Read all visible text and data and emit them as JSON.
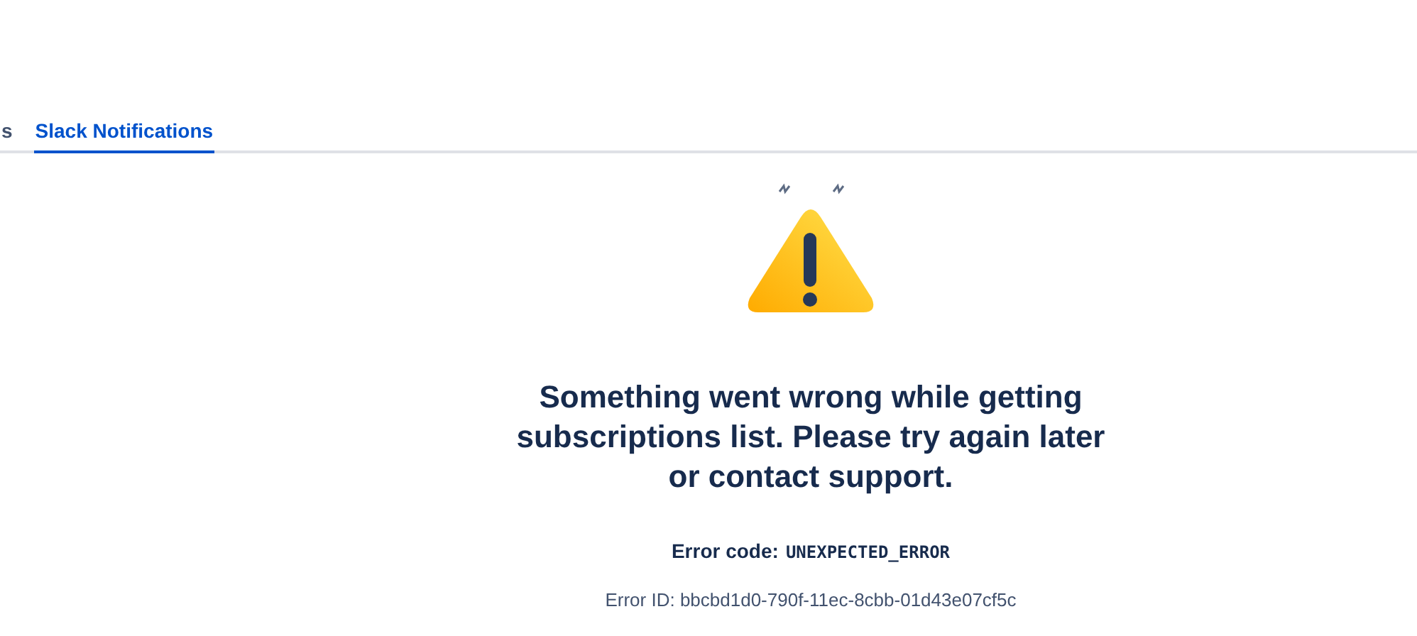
{
  "tabs": [
    {
      "label": "s",
      "selected": false
    },
    {
      "label": "Slack Notifications",
      "selected": true
    }
  ],
  "error": {
    "message": "Something went wrong while getting subscriptions list. Please try again later or contact support.",
    "code_label": "Error code:",
    "code": "UNEXPECTED_ERROR",
    "error_id": "Error ID: bbcbd1d0-790f-11ec-8cbb-01d43e07cf5c"
  }
}
